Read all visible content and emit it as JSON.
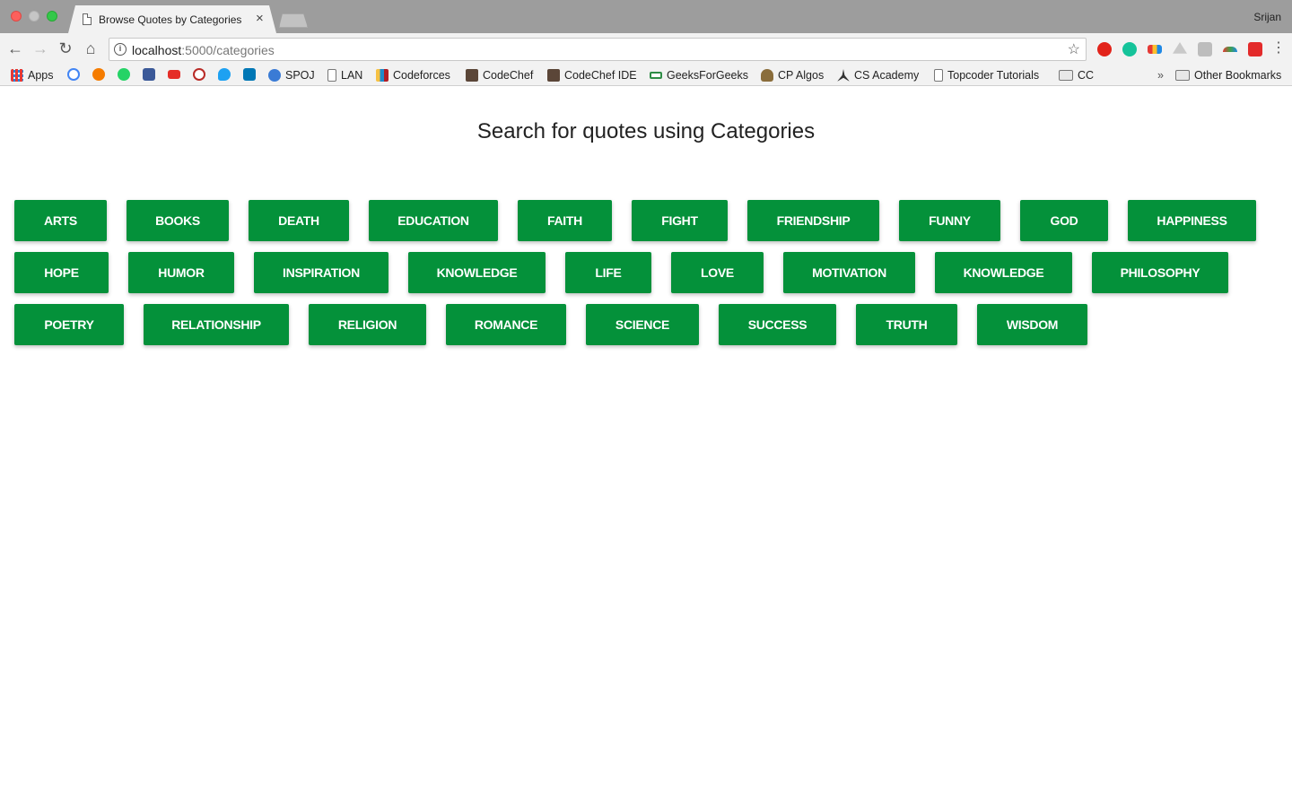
{
  "browser": {
    "tab_title": "Browse Quotes by Categories",
    "tab_close": "×",
    "profile_name": "Srijan",
    "url_host": "localhost",
    "url_path": ":5000/categories"
  },
  "bookmarks": [
    {
      "label": "Apps",
      "icon": "apps-grid-icon",
      "color": "#4a7bd0"
    },
    {
      "label": "SPOJ",
      "icon": "spoj-icon",
      "color": "#3a7bd5"
    },
    {
      "label": "LAN",
      "icon": "page-icon",
      "color": "#ffffff"
    },
    {
      "label": "Codeforces",
      "icon": "codeforces-icon",
      "color": "#1f8acb"
    },
    {
      "label": "CodeChef",
      "icon": "codechef-icon",
      "color": "#5b4638"
    },
    {
      "label": "CodeChef IDE",
      "icon": "codechef-icon",
      "color": "#5b4638"
    },
    {
      "label": "GeeksForGeeks",
      "icon": "geeksforgeeks-icon",
      "color": "#2f8d46"
    },
    {
      "label": "CP Algos",
      "icon": "cp-algos-icon",
      "color": "#8a6d3b"
    },
    {
      "label": "CS Academy",
      "icon": "cs-academy-icon",
      "color": "#333333"
    },
    {
      "label": "Topcoder Tutorials",
      "icon": "page-icon",
      "color": "#ffffff"
    },
    {
      "label": "CC",
      "icon": "folder-icon",
      "color": "#e8e8e8"
    },
    {
      "label": "Other Bookmarks",
      "icon": "folder-icon",
      "color": "#e8e8e8"
    }
  ],
  "bookmarks_overflow": "»",
  "page": {
    "heading": "Search for quotes using Categories",
    "button_color": "#04913a"
  },
  "categories": [
    "ARTS",
    "BOOKS",
    "DEATH",
    "EDUCATION",
    "FAITH",
    "FIGHT",
    "FRIENDSHIP",
    "FUNNY",
    "GOD",
    "HAPPINESS",
    "HOPE",
    "HUMOR",
    "INSPIRATION",
    "KNOWLEDGE",
    "LIFE",
    "LOVE",
    "MOTIVATION",
    "KNOWLEDGE",
    "PHILOSOPHY",
    "POETRY",
    "RELATIONSHIP",
    "RELIGION",
    "ROMANCE",
    "SCIENCE",
    "SUCCESS",
    "TRUTH",
    "WISDOM"
  ]
}
